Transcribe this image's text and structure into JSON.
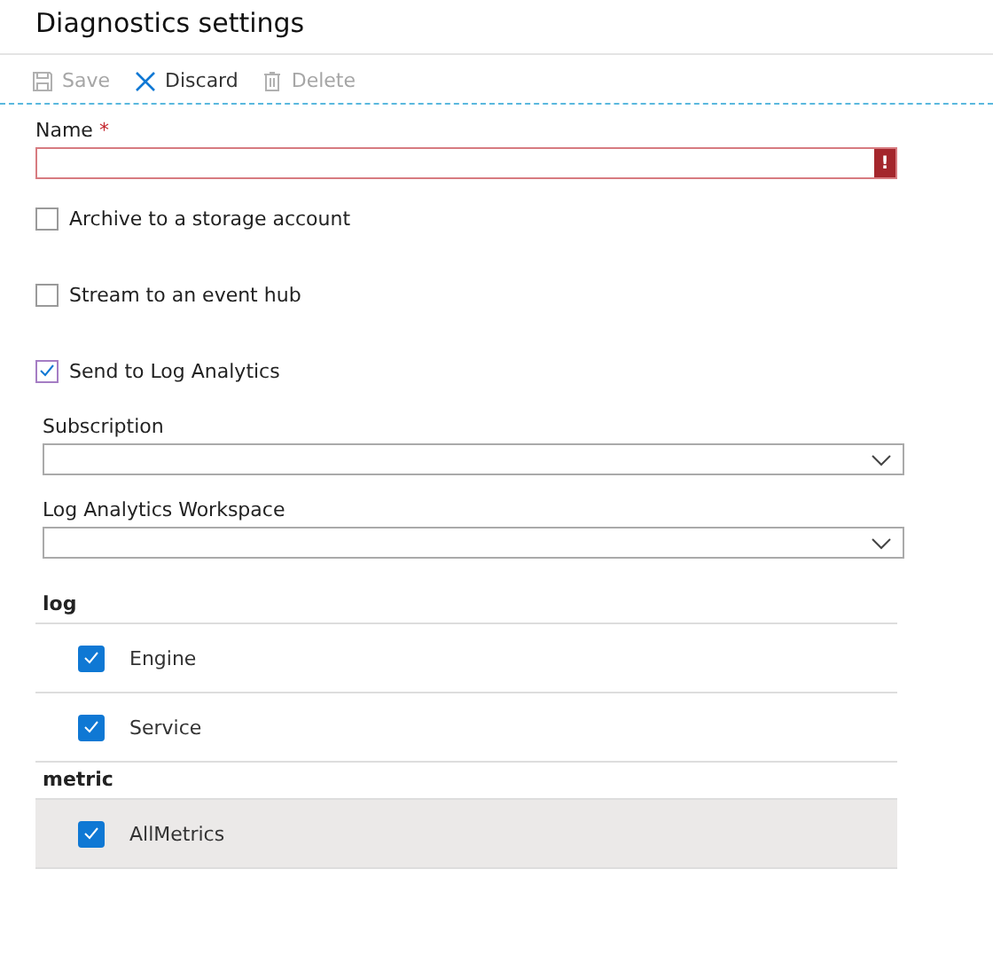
{
  "title": "Diagnostics settings",
  "toolbar": [
    {
      "kind": "save",
      "label": "Save",
      "disabled": true
    },
    {
      "kind": "discard",
      "label": "Discard",
      "disabled": false
    },
    {
      "kind": "delete",
      "label": "Delete",
      "disabled": true
    }
  ],
  "name_field": {
    "label": "Name",
    "required_mark": "*",
    "invalid": true,
    "error_mark": "!"
  },
  "destinations": [
    {
      "label": "Archive to a storage account",
      "checked": false,
      "focused": false
    },
    {
      "label": "Stream to an event hub",
      "checked": false,
      "focused": false
    },
    {
      "label": "Send to Log Analytics",
      "checked": true,
      "focused": true
    }
  ],
  "selects": [
    {
      "label": "Subscription"
    },
    {
      "label": "Log Analytics Workspace"
    }
  ],
  "sections": [
    {
      "heading": "log",
      "items": [
        {
          "label": "Engine",
          "checked": true,
          "highlighted": false
        },
        {
          "label": "Service",
          "checked": true,
          "highlighted": false
        }
      ]
    },
    {
      "heading": "metric",
      "items": [
        {
          "label": "AllMetrics",
          "checked": true,
          "highlighted": true
        }
      ]
    }
  ]
}
